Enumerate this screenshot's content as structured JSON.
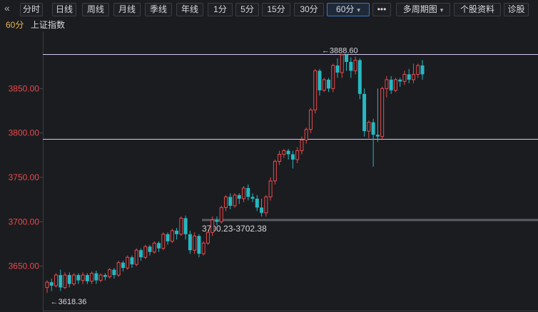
{
  "toolbar": {
    "back_icon": "double-chevron-left-icon",
    "buttons": [
      {
        "label": "分时"
      },
      {
        "label": "日线"
      },
      {
        "label": "周线"
      },
      {
        "label": "月线"
      },
      {
        "label": "季线"
      },
      {
        "label": "年线"
      },
      {
        "label": "1分"
      },
      {
        "label": "5分"
      },
      {
        "label": "15分"
      },
      {
        "label": "30分"
      },
      {
        "label": "60分",
        "active": true,
        "icon": "chevron-down-icon"
      },
      {
        "label": "•••",
        "icon": "more-icon"
      },
      {
        "label": "多周期图",
        "icon": "chevron-down-icon"
      },
      {
        "label": "个股资料"
      },
      {
        "label": "诊股"
      }
    ]
  },
  "subheader": {
    "period": "60分",
    "name": "上证指数"
  },
  "colors": {
    "up": "#e84a4a",
    "down": "#25b8c2",
    "axis_text": "#e84a4a",
    "ref_line": "#d7c8f0",
    "bg": "#1b1c20"
  },
  "chart_data": {
    "type": "candlestick",
    "ylim": [
      3600,
      3908
    ],
    "yticks": [
      3650.0,
      3700.0,
      3750.0,
      3800.0,
      3850.0
    ],
    "ytick_labels": [
      "3650.00",
      "3700.00",
      "3750.00",
      "3800.00",
      "3850.00"
    ],
    "annotations": {
      "high": "3888.60",
      "low": "3618.36",
      "range": "3700.23-3702.38"
    },
    "ref_lines": [
      3888.6,
      3793.5
    ],
    "range_band": [
      3700.23,
      3702.38
    ],
    "candles": [
      [
        3626,
        3632,
        3620,
        3634
      ],
      [
        3632,
        3628,
        3622,
        3636
      ],
      [
        3628,
        3640,
        3626,
        3642
      ],
      [
        3640,
        3626,
        3622,
        3646
      ],
      [
        3626,
        3640,
        3624,
        3643
      ],
      [
        3640,
        3630,
        3626,
        3643
      ],
      [
        3630,
        3640,
        3628,
        3642
      ],
      [
        3640,
        3634,
        3630,
        3642
      ],
      [
        3634,
        3640,
        3630,
        3643
      ],
      [
        3640,
        3633,
        3630,
        3642
      ],
      [
        3633,
        3642,
        3630,
        3644
      ],
      [
        3642,
        3634,
        3630,
        3645
      ],
      [
        3634,
        3640,
        3632,
        3642
      ],
      [
        3640,
        3638,
        3634,
        3642
      ],
      [
        3638,
        3646,
        3636,
        3648
      ],
      [
        3646,
        3640,
        3636,
        3648
      ],
      [
        3640,
        3654,
        3638,
        3656
      ],
      [
        3654,
        3648,
        3644,
        3656
      ],
      [
        3648,
        3660,
        3646,
        3662
      ],
      [
        3660,
        3652,
        3648,
        3662
      ],
      [
        3652,
        3668,
        3650,
        3670
      ],
      [
        3668,
        3660,
        3656,
        3670
      ],
      [
        3660,
        3672,
        3658,
        3674
      ],
      [
        3672,
        3666,
        3662,
        3674
      ],
      [
        3666,
        3676,
        3664,
        3678
      ],
      [
        3676,
        3670,
        3666,
        3678
      ],
      [
        3670,
        3686,
        3668,
        3688
      ],
      [
        3686,
        3678,
        3674,
        3688
      ],
      [
        3678,
        3690,
        3676,
        3692
      ],
      [
        3690,
        3686,
        3680,
        3693
      ],
      [
        3686,
        3704,
        3684,
        3706
      ],
      [
        3704,
        3686,
        3680,
        3707
      ],
      [
        3686,
        3668,
        3664,
        3690
      ],
      [
        3668,
        3684,
        3664,
        3688
      ],
      [
        3684,
        3664,
        3660,
        3686
      ],
      [
        3664,
        3676,
        3662,
        3678
      ],
      [
        3676,
        3688,
        3674,
        3690
      ],
      [
        3688,
        3702,
        3684,
        3706
      ],
      [
        3702,
        3700,
        3696,
        3706
      ],
      [
        3700,
        3716,
        3698,
        3718
      ],
      [
        3716,
        3728,
        3712,
        3730
      ],
      [
        3728,
        3718,
        3714,
        3732
      ],
      [
        3718,
        3730,
        3716,
        3732
      ],
      [
        3730,
        3726,
        3720,
        3732
      ],
      [
        3726,
        3738,
        3722,
        3740
      ],
      [
        3738,
        3728,
        3724,
        3742
      ],
      [
        3728,
        3726,
        3722,
        3732
      ],
      [
        3726,
        3716,
        3712,
        3730
      ],
      [
        3716,
        3710,
        3706,
        3726
      ],
      [
        3710,
        3728,
        3706,
        3730
      ],
      [
        3728,
        3746,
        3724,
        3750
      ],
      [
        3746,
        3768,
        3742,
        3770
      ],
      [
        3768,
        3776,
        3764,
        3780
      ],
      [
        3776,
        3780,
        3772,
        3782
      ],
      [
        3780,
        3776,
        3770,
        3782
      ],
      [
        3776,
        3770,
        3760,
        3780
      ],
      [
        3770,
        3780,
        3766,
        3784
      ],
      [
        3780,
        3792,
        3776,
        3796
      ],
      [
        3792,
        3804,
        3788,
        3806
      ],
      [
        3804,
        3826,
        3800,
        3828
      ],
      [
        3826,
        3870,
        3822,
        3872
      ],
      [
        3870,
        3848,
        3842,
        3872
      ],
      [
        3848,
        3860,
        3846,
        3862
      ],
      [
        3860,
        3850,
        3846,
        3862
      ],
      [
        3850,
        3876,
        3846,
        3878
      ],
      [
        3876,
        3868,
        3862,
        3884
      ],
      [
        3868,
        3888,
        3862,
        3889
      ],
      [
        3888,
        3880,
        3870,
        3889
      ],
      [
        3880,
        3870,
        3862,
        3885
      ],
      [
        3870,
        3882,
        3866,
        3886
      ],
      [
        3882,
        3844,
        3838,
        3884
      ],
      [
        3844,
        3802,
        3796,
        3850
      ],
      [
        3802,
        3812,
        3794,
        3814
      ],
      [
        3812,
        3798,
        3762,
        3816
      ],
      [
        3798,
        3796,
        3790,
        3850
      ],
      [
        3796,
        3850,
        3792,
        3852
      ],
      [
        3850,
        3860,
        3840,
        3864
      ],
      [
        3860,
        3848,
        3844,
        3864
      ],
      [
        3848,
        3860,
        3846,
        3862
      ],
      [
        3860,
        3858,
        3852,
        3862
      ],
      [
        3858,
        3866,
        3854,
        3870
      ],
      [
        3866,
        3860,
        3856,
        3872
      ],
      [
        3860,
        3866,
        3856,
        3878
      ],
      [
        3866,
        3876,
        3862,
        3878
      ],
      [
        3876,
        3866,
        3860,
        3882
      ]
    ]
  }
}
